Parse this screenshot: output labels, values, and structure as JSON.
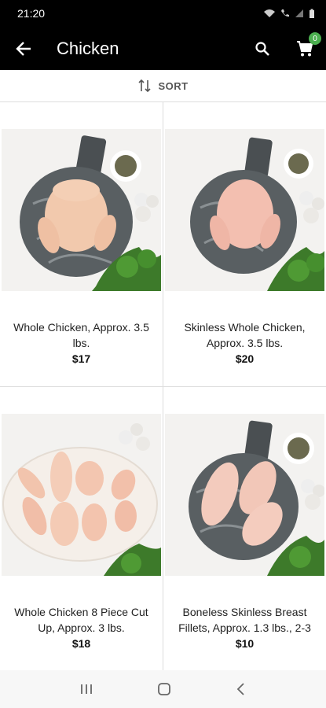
{
  "status_bar": {
    "time": "21:20"
  },
  "app_bar": {
    "title": "Chicken",
    "cart_count": "0"
  },
  "sort": {
    "label": "SORT"
  },
  "products": [
    {
      "name": "Whole Chicken, Approx. 3.5 lbs.",
      "price": "$17"
    },
    {
      "name": "Skinless Whole Chicken, Approx. 3.5 lbs.",
      "price": "$20"
    },
    {
      "name": "Whole Chicken 8 Piece Cut Up, Approx. 3 lbs.",
      "price": "$18"
    },
    {
      "name": "Boneless Skinless Breast Fillets, Approx. 1.3 lbs., 2-3",
      "price": "$10"
    }
  ],
  "colors": {
    "bar": "#000000",
    "badge": "#4caf50"
  }
}
